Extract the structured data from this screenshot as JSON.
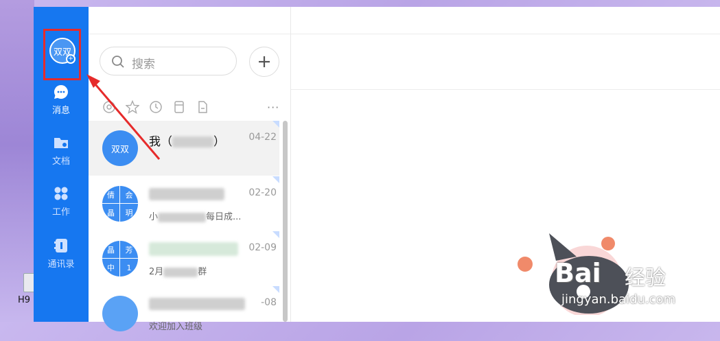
{
  "desktop": {
    "icon_label": "H9"
  },
  "sidebar": {
    "avatar_text": "双双",
    "avatar_badge": "+",
    "items": [
      {
        "label": "消息",
        "icon": "chat-bubble-icon",
        "active": true
      },
      {
        "label": "文档",
        "icon": "folder-icon",
        "active": false
      },
      {
        "label": "工作",
        "icon": "apps-grid-icon",
        "active": false
      },
      {
        "label": "通讯录",
        "icon": "contacts-book-icon",
        "active": false
      }
    ]
  },
  "search": {
    "placeholder": "搜索"
  },
  "add_button": "+",
  "filters": [
    "at-icon",
    "star-icon",
    "clock-icon",
    "file-cabinet-icon",
    "document-icon"
  ],
  "more": "···",
  "conversations": [
    {
      "avatar": "双双",
      "name": "我（",
      "name_suffix": "）",
      "date": "04-22",
      "preview": ""
    },
    {
      "avatar_grid": [
        "倩",
        "会",
        "晶",
        "玥"
      ],
      "name": "",
      "date": "02-20",
      "preview_start": "小",
      "preview_end": "每日成..."
    },
    {
      "avatar_grid": [
        "晶",
        "芳",
        "中",
        "1"
      ],
      "name": "",
      "date": "02-09",
      "preview_start": "2月",
      "preview_end": "群"
    },
    {
      "avatar": "",
      "name": "",
      "date": "-08",
      "preview_start": "欢迎加入班级"
    }
  ],
  "watermark": {
    "brand": "Bai",
    "brand_cn": "经验",
    "url": "jingyan.baidu.com"
  },
  "colors": {
    "sidebar": "#1677f0",
    "highlight": "#e62b2b"
  }
}
